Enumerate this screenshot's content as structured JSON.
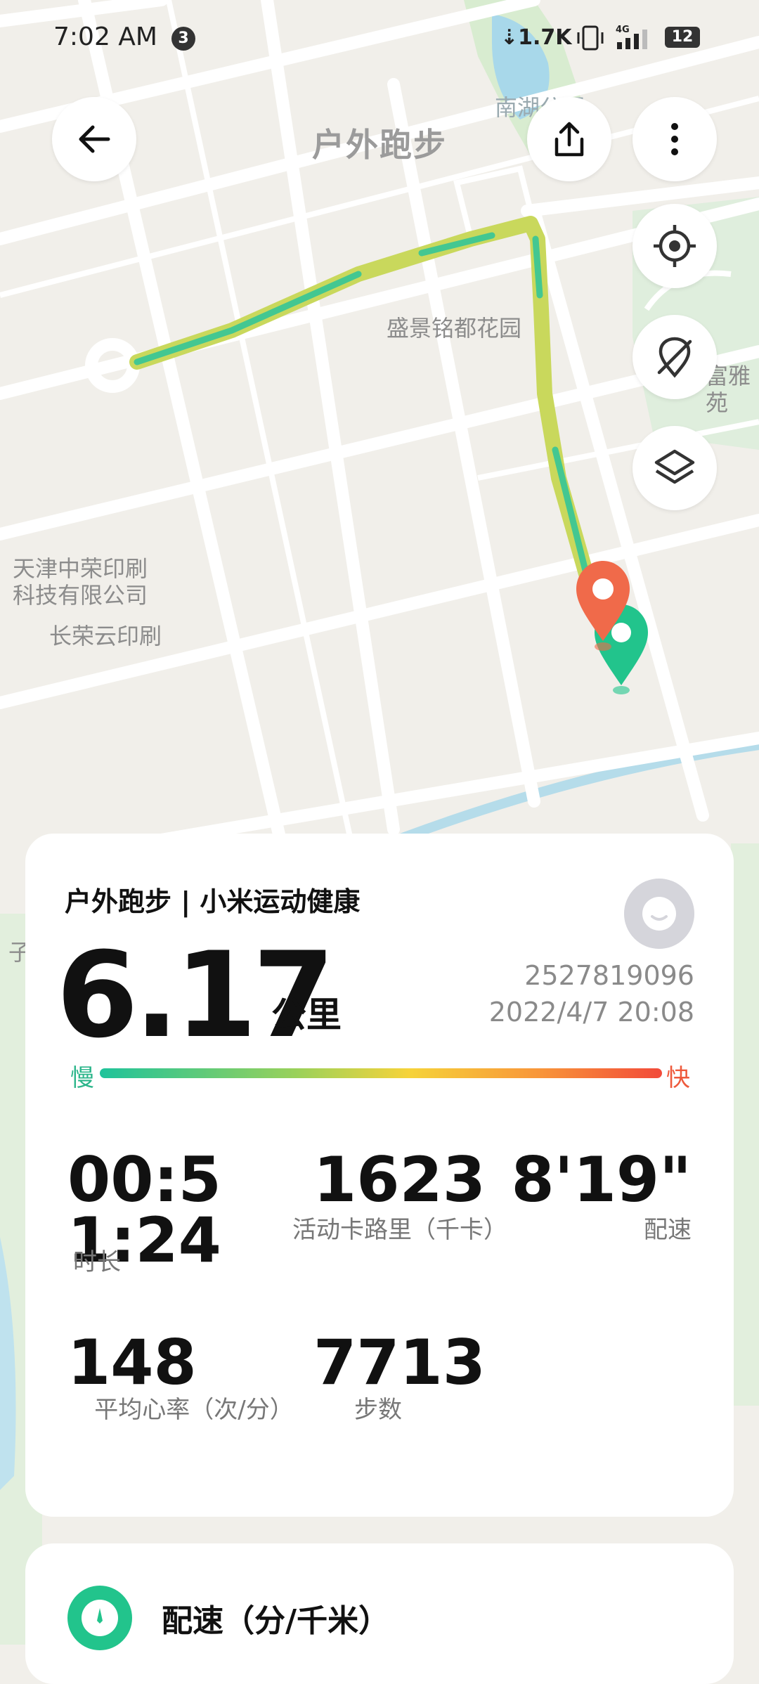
{
  "status_bar": {
    "time": "7:02 AM",
    "notification_count": "3",
    "net_speed": "1.7K",
    "network_type": "4G",
    "battery": "12"
  },
  "header": {
    "title": "户外跑步"
  },
  "map": {
    "labels": {
      "park": "南湖公园",
      "garden": "盛景铭都花园",
      "fuya": "富雅苑",
      "printing1": "天津中荣印刷\n科技有限公司",
      "printing2": "长荣云印刷",
      "edge": "子"
    },
    "colors": {
      "route_slow": "#1fc39b",
      "route_mid": "#c7d85a",
      "start_marker": "#f06a4a",
      "end_marker": "#22c48c"
    }
  },
  "summary": {
    "source": "户外跑步 | 小米运动健康",
    "distance": "6.17",
    "distance_unit": "公里",
    "user_id": "2527819096",
    "date": "2022/4/7 20:08",
    "slow_label": "慢",
    "fast_label": "快",
    "duration": "00:51:24",
    "duration_label": "时长",
    "calories": "1623",
    "calories_label": "活动卡路里（千卡）",
    "pace": "8'19\"",
    "pace_label": "配速",
    "heart_rate": "148",
    "heart_rate_label": "平均心率（次/分）",
    "steps": "7713",
    "steps_label": "步数"
  },
  "pace_section": {
    "title": "配速（分/千米）"
  }
}
